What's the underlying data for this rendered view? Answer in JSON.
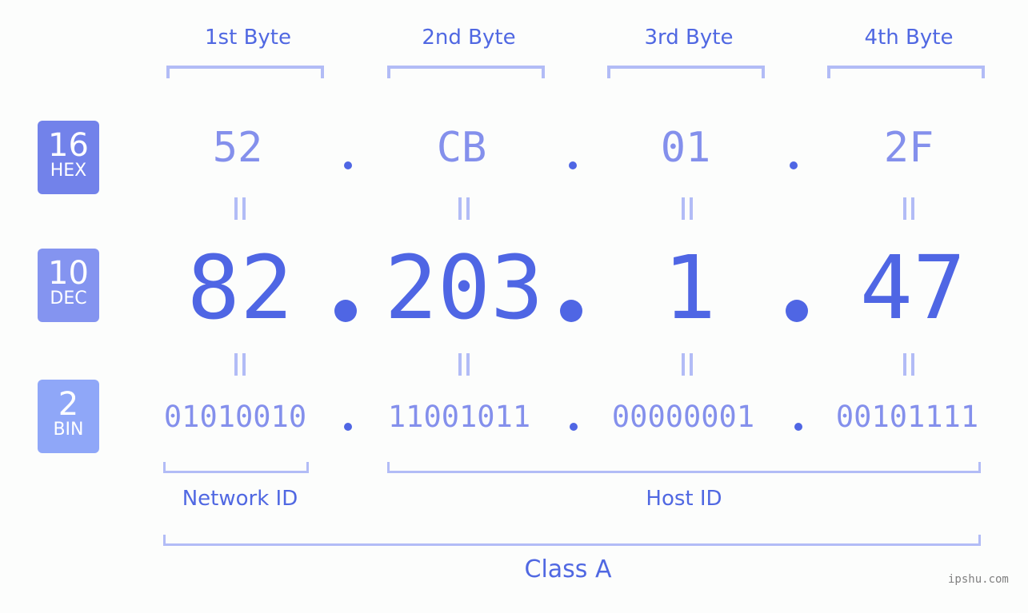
{
  "bytes": [
    {
      "label": "1st Byte",
      "hex": "52",
      "dec": "82",
      "bin": "01010010"
    },
    {
      "label": "2nd Byte",
      "hex": "CB",
      "dec": "203",
      "bin": "11001011"
    },
    {
      "label": "3rd Byte",
      "hex": "01",
      "dec": "1",
      "bin": "00000001"
    },
    {
      "label": "4th Byte",
      "hex": "2F",
      "dec": "47",
      "bin": "00101111"
    }
  ],
  "badges": {
    "hex": {
      "num": "16",
      "label": "HEX",
      "color": "#7282ea"
    },
    "dec": {
      "num": "10",
      "label": "DEC",
      "color": "#8494f0"
    },
    "bin": {
      "num": "2",
      "label": "BIN",
      "color": "#8fa7f8"
    }
  },
  "network_id_label": "Network ID",
  "host_id_label": "Host ID",
  "class_label": "Class A",
  "watermark": "ipshu.com"
}
